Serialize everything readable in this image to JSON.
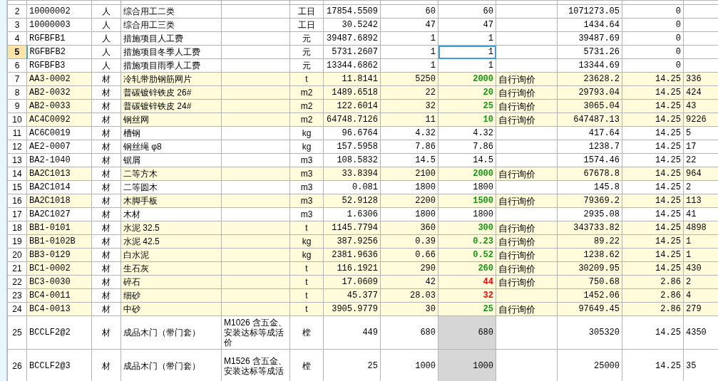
{
  "rows": [
    {
      "num": "2",
      "code": "10000002",
      "type": "人",
      "name": "综合用工二类",
      "unit": "工日",
      "qty": "17854.5509",
      "price": "60",
      "adjusted_price": "60",
      "amount": "1071273.05",
      "rate": "0",
      "highlighted": false,
      "selected": false
    },
    {
      "num": "3",
      "code": "10000003",
      "type": "人",
      "name": "综合用工三类",
      "unit": "工日",
      "qty": "30.5242",
      "price": "47",
      "adjusted_price": "47",
      "amount": "1434.64",
      "rate": "0",
      "highlighted": false,
      "selected": false
    },
    {
      "num": "4",
      "code": "RGFBFB1",
      "type": "人",
      "name": "措施项目人工费",
      "unit": "元",
      "qty": "39487.6892",
      "price": "1",
      "adjusted_price": "1",
      "amount": "39487.69",
      "rate": "0",
      "highlighted": false,
      "selected": false
    },
    {
      "num": "5",
      "code": "RGFBFB2",
      "type": "人",
      "name": "措施项目冬季人工费",
      "unit": "元",
      "qty": "5731.2607",
      "price": "1",
      "adjusted_price": "1",
      "amount": "5731.26",
      "rate": "0",
      "highlighted": false,
      "selected": true
    },
    {
      "num": "6",
      "code": "RGFBFB3",
      "type": "人",
      "name": "措施项目雨季人工费",
      "unit": "元",
      "qty": "13344.6862",
      "price": "1",
      "adjusted_price": "1",
      "amount": "13344.69",
      "rate": "0",
      "highlighted": false,
      "selected": false
    },
    {
      "num": "7",
      "code": "AA3-0002",
      "type": "材",
      "name": "冷轧带肋钢筋网片",
      "unit": "t",
      "qty": "11.8141",
      "price": "5250",
      "adjusted_price": "2000",
      "color": "#119911",
      "source": "自行询价",
      "amount": "23628.2",
      "rate": "14.25",
      "column_14": "336",
      "highlighted": true,
      "selected": false
    },
    {
      "num": "8",
      "code": "AB2-0032",
      "type": "材",
      "name": "普碳镀锌铁皮 26#",
      "unit": "m2",
      "qty": "1489.6518",
      "price": "22",
      "adjusted_price": "20",
      "color": "#119911",
      "source": "自行询价",
      "amount": "29793.04",
      "rate": "14.25",
      "column_14": "424",
      "highlighted": true,
      "selected": false
    },
    {
      "num": "9",
      "code": "AB2-0033",
      "type": "材",
      "name": "普碳镀锌铁皮 24#",
      "unit": "m2",
      "qty": "122.6014",
      "price": "32",
      "adjusted_price": "25",
      "color": "#119911",
      "source": "自行询价",
      "amount": "3065.04",
      "rate": "14.25",
      "column_14": "43",
      "highlighted": true,
      "selected": false
    },
    {
      "num": "10",
      "code": "AC4C0092",
      "type": "材",
      "name": "钢丝网",
      "unit": "m2",
      "qty": "64748.7126",
      "price": "11",
      "adjusted_price": "10",
      "color": "#119911",
      "source": "自行询价",
      "amount": "647487.13",
      "rate": "14.25",
      "column_14": "9226",
      "highlighted": true,
      "selected": false
    },
    {
      "num": "11",
      "code": "AC6C0019",
      "type": "材",
      "name": "槽钢",
      "unit": "kg",
      "qty": "96.6764",
      "price": "4.32",
      "adjusted_price": "4.32",
      "amount": "417.64",
      "rate": "14.25",
      "column_14": "5",
      "highlighted": false,
      "selected": false
    },
    {
      "num": "12",
      "code": "AE2-0007",
      "type": "材",
      "name": "钢丝绳 φ8",
      "unit": "kg",
      "qty": "157.5958",
      "price": "7.86",
      "adjusted_price": "7.86",
      "amount": "1238.7",
      "rate": "14.25",
      "column_14": "17",
      "highlighted": false,
      "selected": false
    },
    {
      "num": "13",
      "code": "BA2-1040",
      "type": "材",
      "name": "锯屑",
      "unit": "m3",
      "qty": "108.5832",
      "price": "14.5",
      "adjusted_price": "14.5",
      "amount": "1574.46",
      "rate": "14.25",
      "column_14": "22",
      "highlighted": false,
      "selected": false
    },
    {
      "num": "14",
      "code": "BA2C1013",
      "type": "材",
      "name": "二等方木",
      "unit": "m3",
      "qty": "33.8394",
      "price": "2100",
      "adjusted_price": "2000",
      "color": "#119911",
      "source": "自行询价",
      "amount": "67678.8",
      "rate": "14.25",
      "column_14": "964",
      "highlighted": true,
      "selected": false
    },
    {
      "num": "15",
      "code": "BA2C1014",
      "type": "材",
      "name": "二等圆木",
      "unit": "m3",
      "qty": "0.081",
      "price": "1800",
      "adjusted_price": "1800",
      "amount": "145.8",
      "rate": "14.25",
      "column_14": "2",
      "highlighted": false,
      "selected": false
    },
    {
      "num": "16",
      "code": "BA2C1018",
      "type": "材",
      "name": "木脚手板",
      "unit": "m3",
      "qty": "52.9128",
      "price": "2200",
      "adjusted_price": "1500",
      "color": "#119911",
      "source": "自行询价",
      "amount": "79369.2",
      "rate": "14.25",
      "column_14": "113",
      "highlighted": true,
      "selected": false
    },
    {
      "num": "17",
      "code": "BA2C1027",
      "type": "材",
      "name": "木材",
      "unit": "m3",
      "qty": "1.6306",
      "price": "1800",
      "adjusted_price": "1800",
      "amount": "2935.08",
      "rate": "14.25",
      "column_14": "41",
      "highlighted": false,
      "selected": false
    },
    {
      "num": "18",
      "code": "BB1-0101",
      "type": "材",
      "name": "水泥 32.5",
      "unit": "t",
      "qty": "1145.7794",
      "price": "360",
      "adjusted_price": "300",
      "color": "#119911",
      "source": "自行询价",
      "amount": "343733.82",
      "rate": "14.25",
      "column_14": "4898",
      "highlighted": true,
      "selected": false
    },
    {
      "num": "19",
      "code": "BB1-0102B",
      "type": "材",
      "name": "水泥 42.5",
      "unit": "kg",
      "qty": "387.9256",
      "price": "0.39",
      "adjusted_price": "0.23",
      "color": "#119911",
      "source": "自行询价",
      "amount": "89.22",
      "rate": "14.25",
      "column_14": "1",
      "highlighted": true,
      "selected": false
    },
    {
      "num": "20",
      "code": "BB3-0129",
      "type": "材",
      "name": "白水泥",
      "unit": "kg",
      "qty": "2381.9636",
      "price": "0.66",
      "adjusted_price": "0.52",
      "color": "#119911",
      "source": "自行询价",
      "amount": "1238.62",
      "rate": "14.25",
      "column_14": "1",
      "highlighted": true,
      "selected": false
    },
    {
      "num": "21",
      "code": "BC1-0002",
      "type": "材",
      "name": "生石灰",
      "unit": "t",
      "qty": "116.1921",
      "price": "290",
      "adjusted_price": "260",
      "color": "#119911",
      "source": "自行询价",
      "amount": "30209.95",
      "rate": "14.25",
      "column_14": "430",
      "highlighted": true,
      "selected": false
    },
    {
      "num": "22",
      "code": "BC3-0030",
      "type": "材",
      "name": "碎石",
      "unit": "t",
      "qty": "17.0609",
      "price": "42",
      "adjusted_price": "44",
      "color": "#ff0000",
      "source": "自行询价",
      "amount": "750.68",
      "rate": "2.86",
      "column_14": "2",
      "highlighted": true,
      "selected": false
    },
    {
      "num": "23",
      "code": "BC4-0011",
      "type": "材",
      "name": "细砂",
      "unit": "t",
      "qty": "45.377",
      "price": "28.03",
      "adjusted_price": "32",
      "color": "#ff0000",
      "amount": "1452.06",
      "rate": "2.86",
      "column_14": "4",
      "highlighted": true,
      "selected": false
    },
    {
      "num": "24",
      "code": "BC4-0013",
      "type": "材",
      "name": "中砂",
      "unit": "t",
      "qty": "3905.9779",
      "price": "30",
      "adjusted_price": "25",
      "color": "#119911",
      "source": "自行询价",
      "amount": "97649.45",
      "rate": "2.86",
      "column_14": "279",
      "highlighted": true,
      "selected": false
    },
    {
      "num": "25",
      "code": "BCCLF2@2",
      "type": "材",
      "name": "成品木门（带门套）",
      "spec": "M1026 含五金、安装达标等成活价",
      "unit": "樘",
      "qty": "449",
      "price": "680",
      "adjusted_price": "680",
      "adjusted_locked": true,
      "amount": "305320",
      "rate": "14.25",
      "column_14": "4350",
      "highlighted": false,
      "selected": false
    },
    {
      "num": "26",
      "code": "BCCLF2@3",
      "type": "材",
      "name": "成品木门（带门套）",
      "spec": "M1526 含五金、安装达标等成活",
      "unit": "樘",
      "qty": "25",
      "price": "1000",
      "adjusted_price": "1000",
      "adjusted_locked": true,
      "amount": "25000",
      "rate": "14.25",
      "column_14": "35",
      "highlighted": false,
      "selected": false
    }
  ]
}
